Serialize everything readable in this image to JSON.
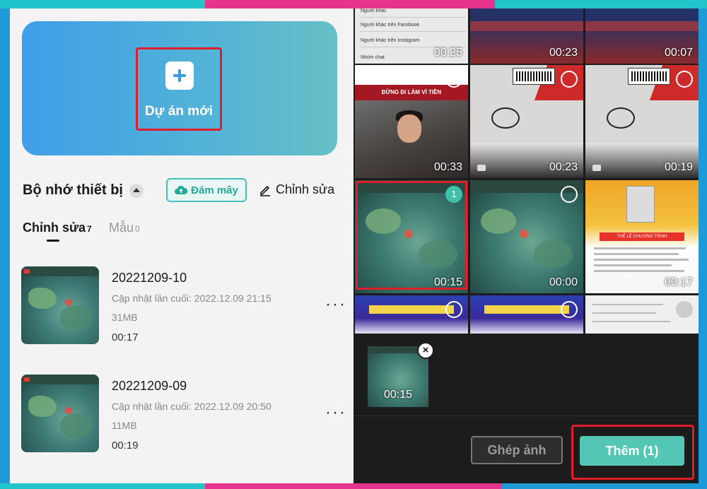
{
  "left": {
    "new_project_label": "Dự án mới",
    "storage_title": "Bộ nhớ thiết bị",
    "cloud_label": "Đám mây",
    "edit_label": "Chỉnh sửa",
    "tabs": [
      {
        "label": "Chỉnh sửa",
        "count": "7",
        "active": true
      },
      {
        "label": "Mẫu",
        "count": "0",
        "active": false
      }
    ],
    "projects": [
      {
        "name": "20221209-10",
        "updated": "Cập nhật lần cuối: 2022.12.09 21:15",
        "size": "31MB",
        "duration": "00:17"
      },
      {
        "name": "20221209-09",
        "updated": "Cập nhật lần cuối: 2022.12.09 20:50",
        "size": "11MB",
        "duration": "00:19"
      }
    ],
    "more_label": "⋮"
  },
  "right": {
    "grid": [
      {
        "duration": "00:25",
        "kind": "facebook-list"
      },
      {
        "duration": "00:23",
        "kind": "shirt"
      },
      {
        "duration": "00:07",
        "kind": "shirt"
      },
      {
        "duration": "00:33",
        "kind": "ad",
        "banner": "ĐỪNG ĐI LÀM VÌ TIỀN"
      },
      {
        "duration": "00:23",
        "kind": "floor"
      },
      {
        "duration": "00:19",
        "kind": "floor"
      },
      {
        "duration": "00:15",
        "kind": "game",
        "selected": "1"
      },
      {
        "duration": "00:00",
        "kind": "game"
      },
      {
        "duration": "00:17",
        "kind": "promo",
        "header": "THỂ LỆ CHƯƠNG TRÌNH"
      },
      {
        "duration": "",
        "kind": "blue"
      },
      {
        "duration": "",
        "kind": "blue"
      },
      {
        "duration": "",
        "kind": "form"
      }
    ],
    "fb_lines": [
      "Người khác",
      "Người khác trên Facebook",
      "Người khác trên Instagram",
      "Nhóm chat"
    ],
    "tray": {
      "duration": "00:15",
      "remove_label": "×"
    },
    "merge_label": "Ghép ảnh",
    "add_label": "Thêm (1)"
  },
  "colors": {
    "accent": "#53c7b4",
    "highlight": "#e01e2a",
    "card_start": "#3f9ee8",
    "card_end": "#66c0c4"
  }
}
